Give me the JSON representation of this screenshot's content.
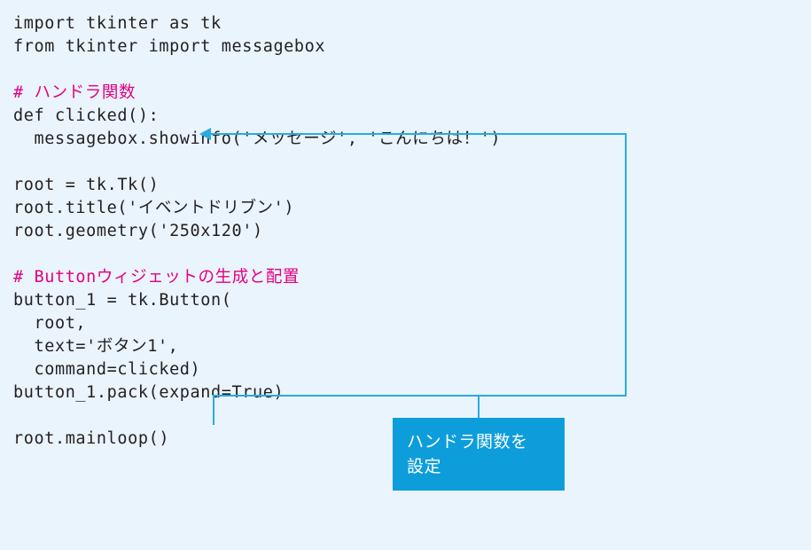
{
  "figure": {
    "background_color": "#eaf4fd",
    "code_color": "#231f20",
    "comment_color": "#e4007f",
    "accent_color": "#29abe2",
    "callout_color": "#0d9ddb"
  },
  "code": {
    "language": "python",
    "lines": [
      {
        "id": "l01",
        "text": "import tkinter as tk",
        "kind": "code"
      },
      {
        "id": "l02",
        "text": "from tkinter import messagebox",
        "kind": "code"
      },
      {
        "id": "l03",
        "text": "",
        "kind": "blank"
      },
      {
        "id": "l04",
        "text": "# ハンドラ関数",
        "kind": "comment"
      },
      {
        "id": "l05",
        "text": "def clicked():",
        "kind": "code"
      },
      {
        "id": "l06",
        "text": "  messagebox.showinfo('メッセージ', 'こんにちは！')",
        "kind": "code"
      },
      {
        "id": "l07",
        "text": "",
        "kind": "blank"
      },
      {
        "id": "l08",
        "text": "root = tk.Tk()",
        "kind": "code"
      },
      {
        "id": "l09",
        "text": "root.title('イベントドリブン')",
        "kind": "code"
      },
      {
        "id": "l10",
        "text": "root.geometry('250x120')",
        "kind": "code"
      },
      {
        "id": "l11",
        "text": "",
        "kind": "blank"
      },
      {
        "id": "l12",
        "text": "# Buttonウィジェットの生成と配置",
        "kind": "comment"
      },
      {
        "id": "l13",
        "text": "button_1 = tk.Button(",
        "kind": "code"
      },
      {
        "id": "l14",
        "text": "  root,",
        "kind": "code"
      },
      {
        "id": "l15",
        "text": "  text='ボタン1',",
        "kind": "code"
      },
      {
        "id": "l16",
        "text": "  command=clicked)",
        "kind": "code"
      },
      {
        "id": "l17",
        "text": "button_1.pack(expand=True)",
        "kind": "code"
      },
      {
        "id": "l18",
        "text": "",
        "kind": "blank"
      },
      {
        "id": "l19",
        "text": "root.mainloop()",
        "kind": "code"
      }
    ]
  },
  "annotation": {
    "callout_lines": [
      "ハンドラ関数を",
      "設定"
    ],
    "target_label": "def clicked():"
  }
}
